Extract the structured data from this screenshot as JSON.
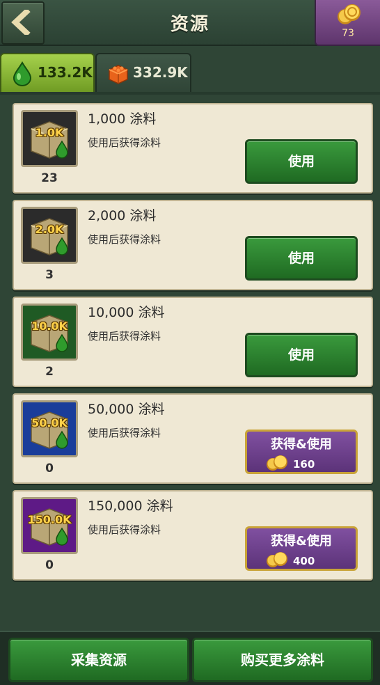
{
  "header": {
    "title": "资源",
    "gold": "73",
    "back_icon": "back-chevron-icon",
    "gold_icon": "gold-coins-icon"
  },
  "tabs": [
    {
      "label": "133.2K",
      "icon": "green-paint-drop-icon",
      "active": true
    },
    {
      "label": "332.9K",
      "icon": "orange-brick-icon",
      "active": false
    }
  ],
  "items": [
    {
      "badge": "1.0K",
      "count": "23",
      "name": "1,000 涂料",
      "desc": "使用后获得涂料",
      "action": "使用",
      "price": null,
      "tile_color": "#2b2b2b"
    },
    {
      "badge": "2.0K",
      "count": "3",
      "name": "2,000 涂料",
      "desc": "使用后获得涂料",
      "action": "使用",
      "price": null,
      "tile_color": "#2b2b2b"
    },
    {
      "badge": "10.0K",
      "count": "2",
      "name": "10,000 涂料",
      "desc": "使用后获得涂料",
      "action": "使用",
      "price": null,
      "tile_color": "#1f5a24"
    },
    {
      "badge": "50.0K",
      "count": "0",
      "name": "50,000 涂料",
      "desc": "使用后获得涂料",
      "action": "获得&使用",
      "price": "160",
      "tile_color": "#1a3d9a"
    },
    {
      "badge": "150.0K",
      "count": "0",
      "name": "150,000 涂料",
      "desc": "使用后获得涂料",
      "action": "获得&使用",
      "price": "400",
      "tile_color": "#5e1a86"
    }
  ],
  "bottom": {
    "collect": "采集资源",
    "buy_more": "购买更多涂料"
  },
  "colors": {
    "accent_green": "#2e8a33",
    "purple": "#6b3f8a",
    "gold": "#e8b33a",
    "card": "#efe8d4"
  }
}
